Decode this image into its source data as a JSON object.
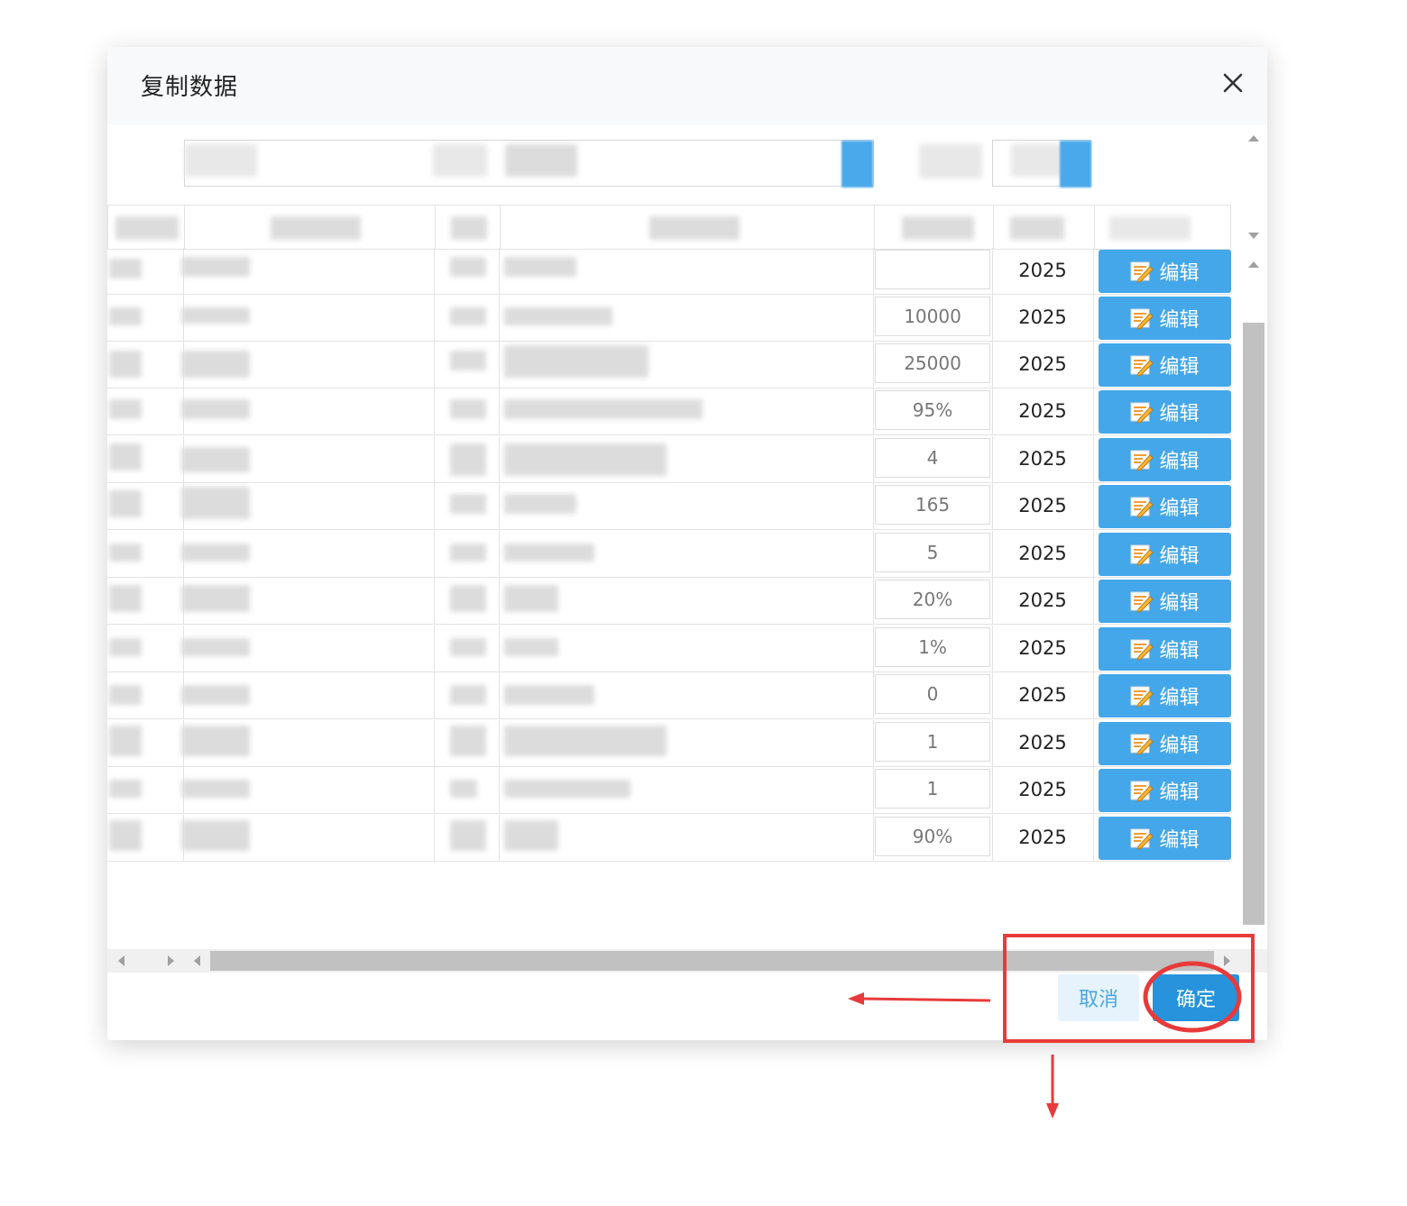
{
  "dialog": {
    "title": "复制数据",
    "close_icon": "close-icon"
  },
  "table": {
    "rows": [
      {
        "value": "",
        "year": "2025",
        "edit_label": "编辑"
      },
      {
        "value": "10000",
        "year": "2025",
        "edit_label": "编辑"
      },
      {
        "value": "25000",
        "year": "2025",
        "edit_label": "编辑"
      },
      {
        "value": "95%",
        "year": "2025",
        "edit_label": "编辑"
      },
      {
        "value": "4",
        "year": "2025",
        "edit_label": "编辑"
      },
      {
        "value": "165",
        "year": "2025",
        "edit_label": "编辑"
      },
      {
        "value": "5",
        "year": "2025",
        "edit_label": "编辑"
      },
      {
        "value": "20%",
        "year": "2025",
        "edit_label": "编辑"
      },
      {
        "value": "1%",
        "year": "2025",
        "edit_label": "编辑"
      },
      {
        "value": "0",
        "year": "2025",
        "edit_label": "编辑"
      },
      {
        "value": "1",
        "year": "2025",
        "edit_label": "编辑"
      },
      {
        "value": "1",
        "year": "2025",
        "edit_label": "编辑"
      },
      {
        "value": "90%",
        "year": "2025",
        "edit_label": "编辑"
      }
    ]
  },
  "footer": {
    "cancel_label": "取消",
    "ok_label": "确定"
  },
  "colors": {
    "primary": "#2693dc",
    "edit_button": "#44a7ea",
    "annotation": "#e83a3a"
  }
}
